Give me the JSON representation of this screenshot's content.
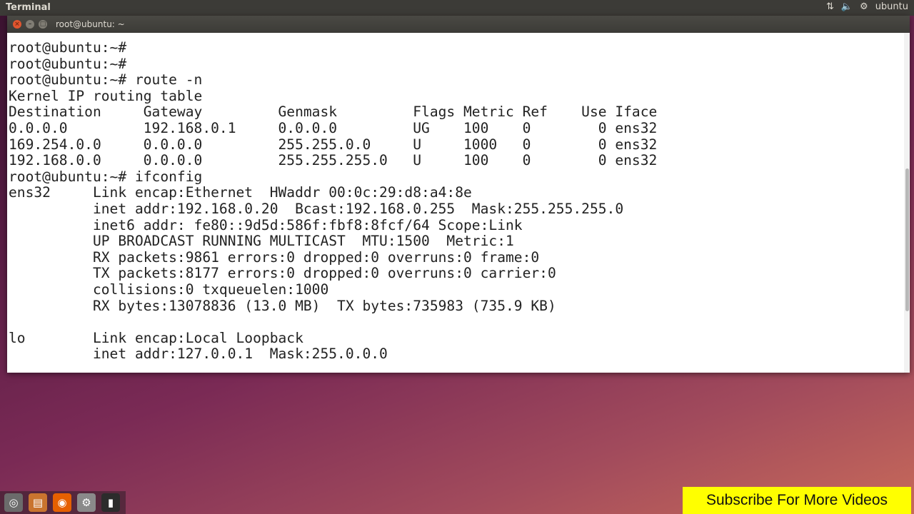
{
  "panel": {
    "app_title": "Terminal",
    "user_label": "ubuntu",
    "network_icon": "network-arrows-icon",
    "volume_icon": "speaker-icon",
    "settings_icon": "gear-icon"
  },
  "window": {
    "title": "root@ubuntu: ~",
    "close_glyph": "×",
    "min_glyph": "–",
    "max_glyph": "□"
  },
  "terminal": {
    "lines": [
      "root@ubuntu:~#",
      "root@ubuntu:~#",
      "root@ubuntu:~# route -n",
      "Kernel IP routing table",
      "Destination     Gateway         Genmask         Flags Metric Ref    Use Iface",
      "0.0.0.0         192.168.0.1     0.0.0.0         UG    100    0        0 ens32",
      "169.254.0.0     0.0.0.0         255.255.0.0     U     1000   0        0 ens32",
      "192.168.0.0     0.0.0.0         255.255.255.0   U     100    0        0 ens32",
      "root@ubuntu:~# ifconfig",
      "ens32     Link encap:Ethernet  HWaddr 00:0c:29:d8:a4:8e",
      "          inet addr:192.168.0.20  Bcast:192.168.0.255  Mask:255.255.255.0",
      "          inet6 addr: fe80::9d5d:586f:fbf8:8fcf/64 Scope:Link",
      "          UP BROADCAST RUNNING MULTICAST  MTU:1500  Metric:1",
      "          RX packets:9861 errors:0 dropped:0 overruns:0 frame:0",
      "          TX packets:8177 errors:0 dropped:0 overruns:0 carrier:0",
      "          collisions:0 txqueuelen:1000",
      "          RX bytes:13078836 (13.0 MB)  TX bytes:735983 (735.9 KB)",
      "",
      "lo        Link encap:Local Loopback",
      "          inet addr:127.0.0.1  Mask:255.0.0.0"
    ]
  },
  "launcher": {
    "items": [
      {
        "icon": "dash-icon",
        "glyph": "◎",
        "color": "#6b6b6b"
      },
      {
        "icon": "files-icon",
        "glyph": "▤",
        "color": "#c9742f"
      },
      {
        "icon": "firefox-icon",
        "glyph": "◉",
        "color": "#e66000"
      },
      {
        "icon": "settings-icon",
        "glyph": "⚙",
        "color": "#8a8a8a"
      },
      {
        "icon": "terminal-icon",
        "glyph": "▮",
        "color": "#2c2c2c"
      }
    ]
  },
  "overlay": {
    "subscribe_text": "Subscribe For More Videos"
  }
}
